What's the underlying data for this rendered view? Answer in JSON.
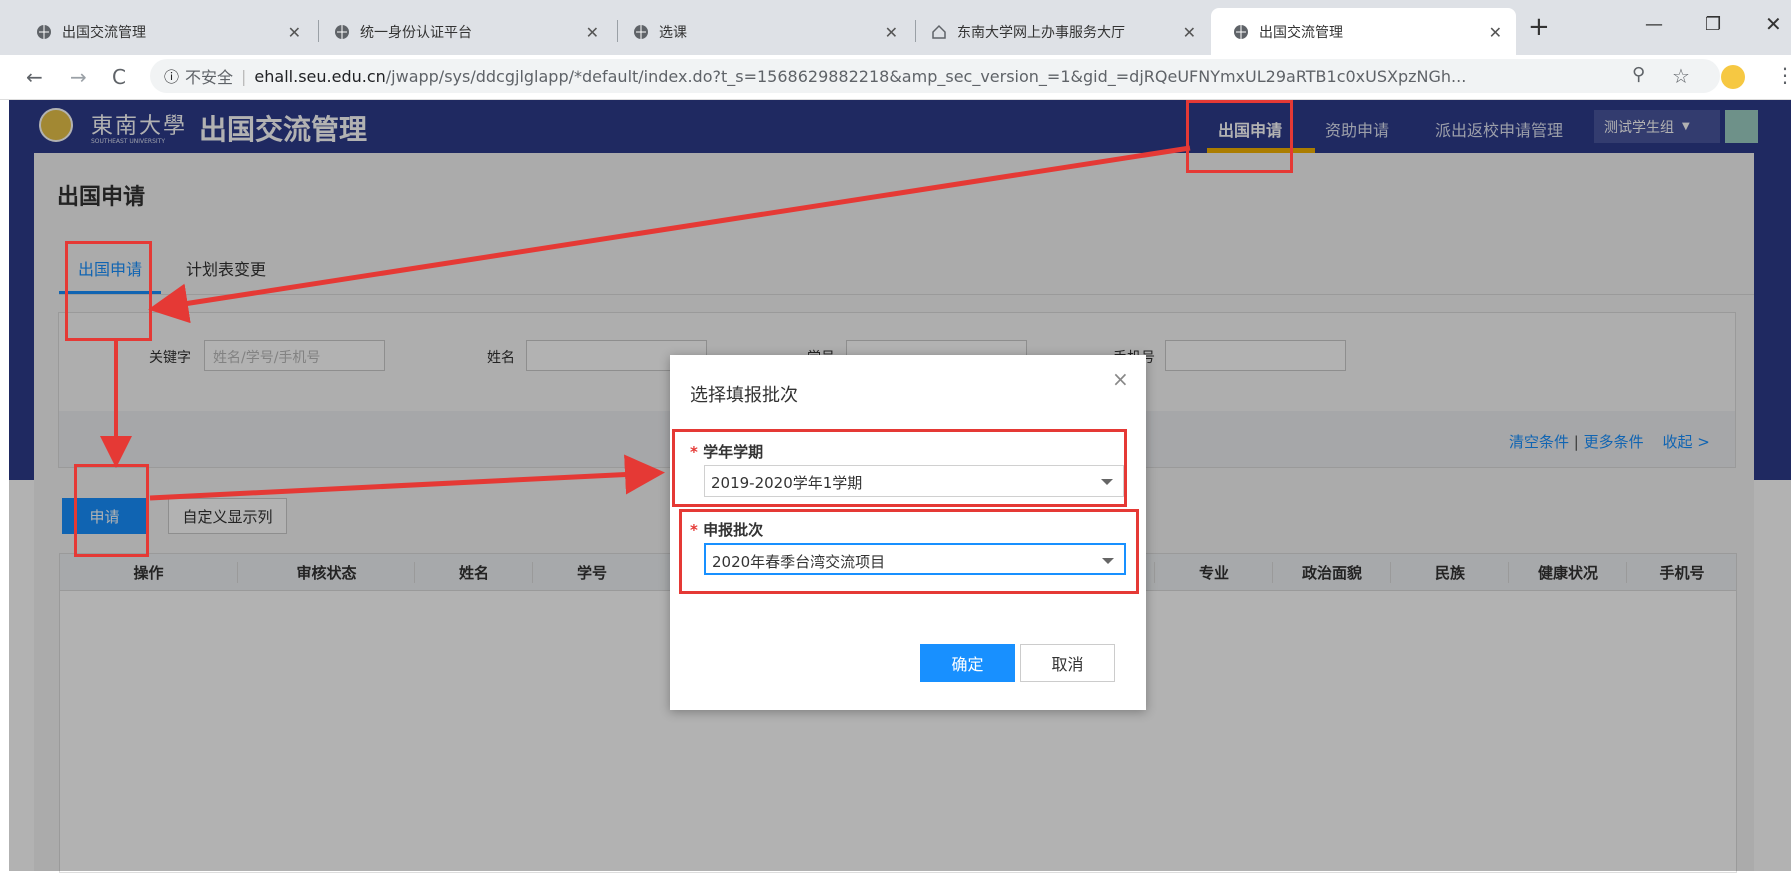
{
  "browser": {
    "tabs": [
      {
        "title": "出国交流管理"
      },
      {
        "title": "统一身份认证平台"
      },
      {
        "title": "选课"
      },
      {
        "title": "东南大学网上办事服务大厅"
      },
      {
        "title": "出国交流管理"
      }
    ],
    "new_tab": "+",
    "security": "不安全",
    "url_host": "ehall.seu.edu.cn",
    "url_path": "/jwapp/sys/ddcgjlglapp/*default/index.do?t_s=1568629882218&amp_sec_version_=1&gid_=djRQeUFNYmxUL29aRTB1c0xUSXpzNGh..."
  },
  "app": {
    "logo_text": "東南大學",
    "logo_sub": "SOUTHEAST UNIVERSITY",
    "title": "出国交流管理",
    "nav": [
      "出国申请",
      "资助申请",
      "派出返校申请管理"
    ],
    "user": "测试学生组"
  },
  "page": {
    "title": "出国申请",
    "tabs": [
      "出国申请",
      "计划表变更"
    ],
    "search": {
      "keyword_label": "关键字",
      "keyword_placeholder": "姓名/学号/手机号",
      "name_label": "姓名",
      "xh_label": "学号",
      "phone_label": "手机号",
      "clear": "清空条件",
      "sep": "|",
      "more": "更多条件",
      "collapse": "收起 >"
    },
    "buttons": {
      "apply": "申请",
      "custom_columns": "自定义显示列"
    },
    "table_headers": [
      "操作",
      "审核状态",
      "姓名",
      "学号",
      "专业",
      "政治面貌",
      "民族",
      "健康状况",
      "手机号"
    ]
  },
  "dialog": {
    "title": "选择填报批次",
    "close": "×",
    "required_mark": "*",
    "field1_label": "学年学期",
    "field1_value": "2019-2020学年1学期",
    "field2_label": "申报批次",
    "field2_value": "2020年春季台湾交流项目",
    "ok": "确定",
    "cancel": "取消"
  },
  "colors": {
    "header": "#2d3b8c",
    "accent": "#1890ff",
    "annotation": "#e53935"
  }
}
